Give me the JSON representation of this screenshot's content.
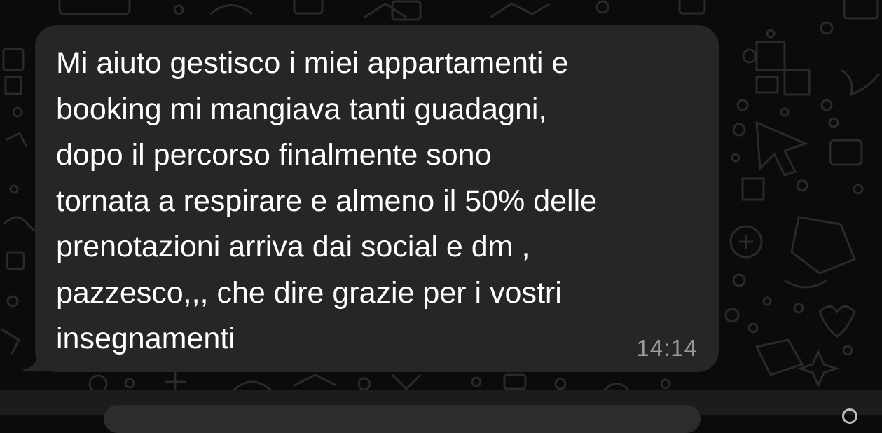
{
  "message": {
    "lines": [
      "Mi aiuto gestisco i miei appartamenti e",
      "booking mi mangiava tanti guadagni,",
      "dopo il percorso finalmente sono",
      "tornata a respirare e almeno il 50% delle",
      "prenotazioni arriva dai social e dm ,",
      "pazzesco,,, che dire grazie per i vostri",
      "insegnamenti"
    ],
    "time": "14:14"
  },
  "colors": {
    "background": "#0b0b0b",
    "bubble": "#262626",
    "text": "#ffffff",
    "timestamp": "#9a9a9a",
    "doodle": "#2a2a2a"
  },
  "icons": [
    "chat-doodle-pattern",
    "message-tail",
    "composer-icon"
  ]
}
